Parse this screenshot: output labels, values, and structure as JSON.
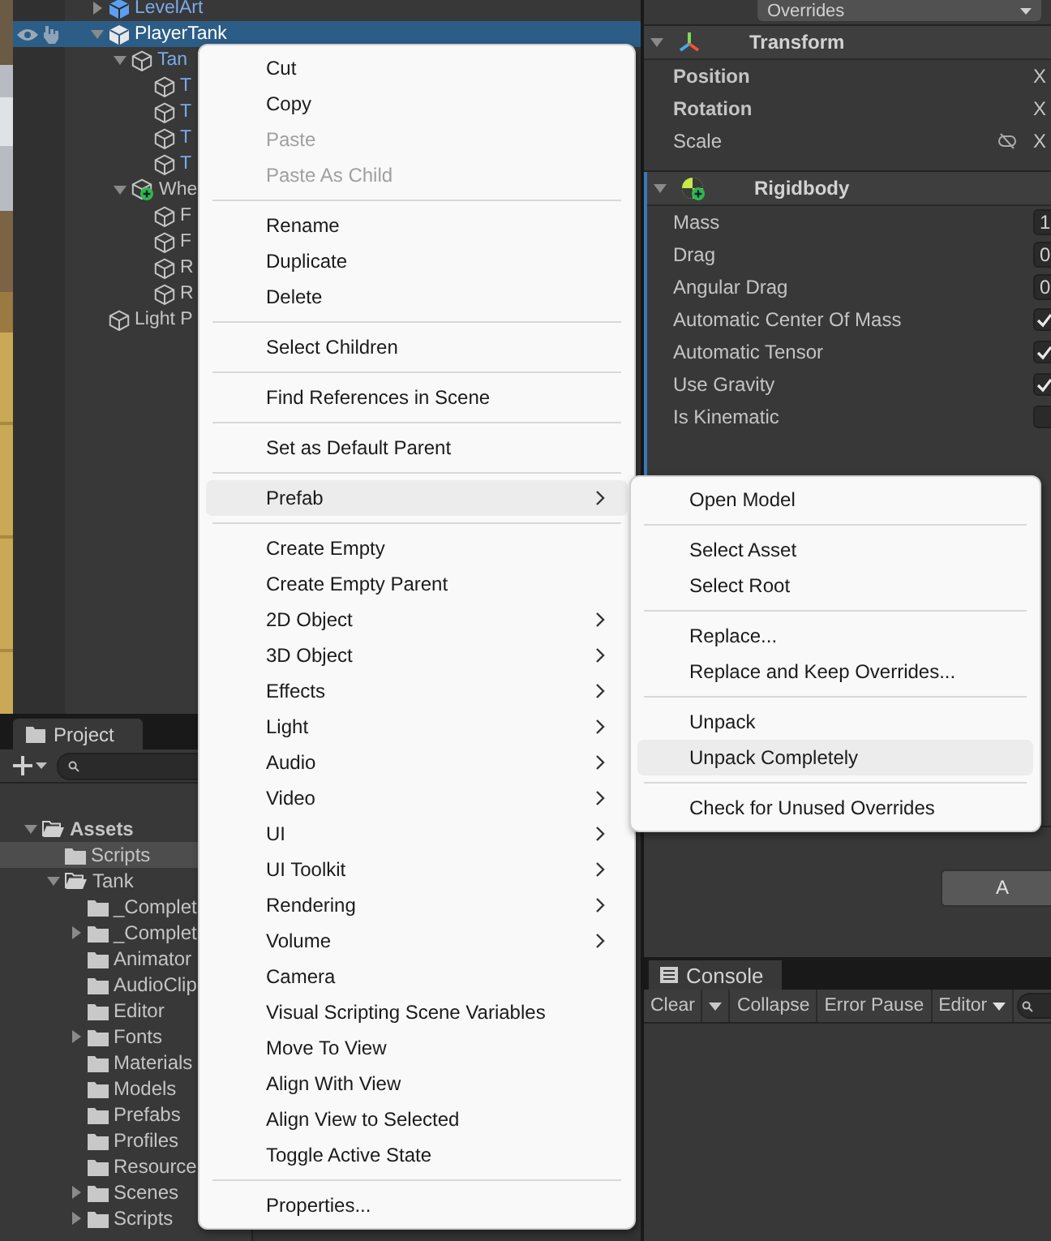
{
  "hierarchy": {
    "items": [
      {
        "label": "LevelArt",
        "kind": "prefab_root",
        "selected": false,
        "expanded": false
      },
      {
        "label": "PlayerTank",
        "kind": "prefab_root",
        "selected": true,
        "expanded": true,
        "children": [
          {
            "label": "Tan",
            "kind": "prefab",
            "selected": false,
            "expanded": true,
            "children": [
              {
                "label": "T",
                "kind": "prefab",
                "selected": false
              },
              {
                "label": "T",
                "kind": "prefab",
                "selected": false
              },
              {
                "label": "T",
                "kind": "prefab",
                "selected": false
              },
              {
                "label": "T",
                "kind": "prefab",
                "selected": false
              }
            ]
          },
          {
            "label": "Whe",
            "kind": "added",
            "selected": false,
            "expanded": true,
            "children": [
              {
                "label": "F",
                "kind": "object",
                "selected": false
              },
              {
                "label": "F",
                "kind": "object",
                "selected": false
              },
              {
                "label": "R",
                "kind": "object",
                "selected": false
              },
              {
                "label": "R",
                "kind": "object",
                "selected": false
              }
            ]
          }
        ]
      },
      {
        "label": "Light P",
        "kind": "object",
        "selected": false
      }
    ]
  },
  "project": {
    "tab": "Project",
    "tree": [
      {
        "label": "Assets",
        "selected": false,
        "expanded": true,
        "children": [
          {
            "label": "Scripts",
            "selected": true
          },
          {
            "label": "Tank",
            "selected": false,
            "expanded": true,
            "children": [
              {
                "label": "_Complet",
                "selected": false
              },
              {
                "label": "_Complet",
                "selected": false,
                "expanded": false
              },
              {
                "label": "Animator",
                "selected": false
              },
              {
                "label": "AudioClip",
                "selected": false
              },
              {
                "label": "Editor",
                "selected": false
              },
              {
                "label": "Fonts",
                "selected": false,
                "expanded": false
              },
              {
                "label": "Materials",
                "selected": false
              },
              {
                "label": "Models",
                "selected": false
              },
              {
                "label": "Prefabs",
                "selected": false
              },
              {
                "label": "Profiles",
                "selected": false
              },
              {
                "label": "Resource",
                "selected": false
              },
              {
                "label": "Scenes",
                "selected": false,
                "expanded": false
              },
              {
                "label": "Scripts",
                "selected": false,
                "expanded": false
              }
            ]
          }
        ]
      }
    ]
  },
  "inspector": {
    "overrides": "Overrides",
    "components": [
      {
        "title": "Transform",
        "kind": "transform",
        "expanded": true,
        "fields": [
          {
            "label": "Position",
            "kind": "vector",
            "bold": true,
            "value": "X"
          },
          {
            "label": "Rotation",
            "kind": "vector",
            "bold": true,
            "value": "X"
          },
          {
            "label": "Scale",
            "kind": "scale",
            "bold": false,
            "value": "X"
          }
        ]
      },
      {
        "title": "Rigidbody",
        "kind": "rigidbody",
        "expanded": true,
        "fields": [
          {
            "label": "Mass",
            "kind": "number",
            "value": "1"
          },
          {
            "label": "Drag",
            "kind": "number",
            "value": "0"
          },
          {
            "label": "Angular Drag",
            "kind": "number",
            "value": "0"
          },
          {
            "label": "Automatic Center Of Mass",
            "kind": "checkbox",
            "checked": true
          },
          {
            "label": "Automatic Tensor",
            "kind": "checkbox",
            "checked": true
          },
          {
            "label": "Use Gravity",
            "kind": "checkbox",
            "checked": true
          },
          {
            "label": "Is Kinematic",
            "kind": "checkbox",
            "checked": false
          }
        ]
      }
    ],
    "add_button": "A"
  },
  "console": {
    "tab": "Console",
    "toolbar": [
      {
        "label": "Clear",
        "kind": "button"
      },
      {
        "kind": "dropdown"
      },
      {
        "label": "Collapse",
        "kind": "button"
      },
      {
        "label": "Error Pause",
        "kind": "button"
      },
      {
        "label": "Editor",
        "kind": "menu"
      }
    ]
  },
  "menu": {
    "items": [
      {
        "kind": "item",
        "label": "Cut",
        "disabled": false,
        "submenu": false,
        "selected": false
      },
      {
        "kind": "item",
        "label": "Copy",
        "disabled": false,
        "submenu": false,
        "selected": false
      },
      {
        "kind": "item",
        "label": "Paste",
        "disabled": true,
        "submenu": false,
        "selected": false
      },
      {
        "kind": "item",
        "label": "Paste As Child",
        "disabled": true,
        "submenu": false,
        "selected": false
      },
      {
        "kind": "separator"
      },
      {
        "kind": "item",
        "label": "Rename",
        "disabled": false,
        "submenu": false,
        "selected": false
      },
      {
        "kind": "item",
        "label": "Duplicate",
        "disabled": false,
        "submenu": false,
        "selected": false
      },
      {
        "kind": "item",
        "label": "Delete",
        "disabled": false,
        "submenu": false,
        "selected": false
      },
      {
        "kind": "separator"
      },
      {
        "kind": "item",
        "label": "Select Children",
        "disabled": false,
        "submenu": false,
        "selected": false
      },
      {
        "kind": "separator"
      },
      {
        "kind": "item",
        "label": "Find References in Scene",
        "disabled": false,
        "submenu": false,
        "selected": false
      },
      {
        "kind": "separator"
      },
      {
        "kind": "item",
        "label": "Set as Default Parent",
        "disabled": false,
        "submenu": false,
        "selected": false
      },
      {
        "kind": "separator"
      },
      {
        "kind": "item",
        "label": "Prefab",
        "disabled": false,
        "submenu": true,
        "selected": true
      },
      {
        "kind": "separator"
      },
      {
        "kind": "item",
        "label": "Create Empty",
        "disabled": false,
        "submenu": false,
        "selected": false
      },
      {
        "kind": "item",
        "label": "Create Empty Parent",
        "disabled": false,
        "submenu": false,
        "selected": false
      },
      {
        "kind": "item",
        "label": "2D Object",
        "disabled": false,
        "submenu": true,
        "selected": false
      },
      {
        "kind": "item",
        "label": "3D Object",
        "disabled": false,
        "submenu": true,
        "selected": false
      },
      {
        "kind": "item",
        "label": "Effects",
        "disabled": false,
        "submenu": true,
        "selected": false
      },
      {
        "kind": "item",
        "label": "Light",
        "disabled": false,
        "submenu": true,
        "selected": false
      },
      {
        "kind": "item",
        "label": "Audio",
        "disabled": false,
        "submenu": true,
        "selected": false
      },
      {
        "kind": "item",
        "label": "Video",
        "disabled": false,
        "submenu": true,
        "selected": false
      },
      {
        "kind": "item",
        "label": "UI",
        "disabled": false,
        "submenu": true,
        "selected": false
      },
      {
        "kind": "item",
        "label": "UI Toolkit",
        "disabled": false,
        "submenu": true,
        "selected": false
      },
      {
        "kind": "item",
        "label": "Rendering",
        "disabled": false,
        "submenu": true,
        "selected": false
      },
      {
        "kind": "item",
        "label": "Volume",
        "disabled": false,
        "submenu": true,
        "selected": false
      },
      {
        "kind": "item",
        "label": "Camera",
        "disabled": false,
        "submenu": false,
        "selected": false
      },
      {
        "kind": "item",
        "label": "Visual Scripting Scene Variables",
        "disabled": false,
        "submenu": false,
        "selected": false
      },
      {
        "kind": "item",
        "label": "Move To View",
        "disabled": false,
        "submenu": false,
        "selected": false
      },
      {
        "kind": "item",
        "label": "Align With View",
        "disabled": false,
        "submenu": false,
        "selected": false
      },
      {
        "kind": "item",
        "label": "Align View to Selected",
        "disabled": false,
        "submenu": false,
        "selected": false
      },
      {
        "kind": "item",
        "label": "Toggle Active State",
        "disabled": false,
        "submenu": false,
        "selected": false
      },
      {
        "kind": "separator"
      },
      {
        "kind": "item",
        "label": "Properties...",
        "disabled": false,
        "submenu": false,
        "selected": false
      }
    ]
  },
  "submenu": {
    "items": [
      {
        "kind": "item",
        "label": "Open Model",
        "selected": false
      },
      {
        "kind": "separator"
      },
      {
        "kind": "item",
        "label": "Select Asset",
        "selected": false
      },
      {
        "kind": "item",
        "label": "Select Root",
        "selected": false
      },
      {
        "kind": "separator"
      },
      {
        "kind": "item",
        "label": "Replace...",
        "selected": false
      },
      {
        "kind": "item",
        "label": "Replace and Keep Overrides...",
        "selected": false
      },
      {
        "kind": "separator"
      },
      {
        "kind": "item",
        "label": "Unpack",
        "selected": false
      },
      {
        "kind": "item",
        "label": "Unpack Completely",
        "selected": true
      },
      {
        "kind": "separator"
      },
      {
        "kind": "item",
        "label": "Check for Unused Overrides",
        "selected": false
      }
    ]
  }
}
